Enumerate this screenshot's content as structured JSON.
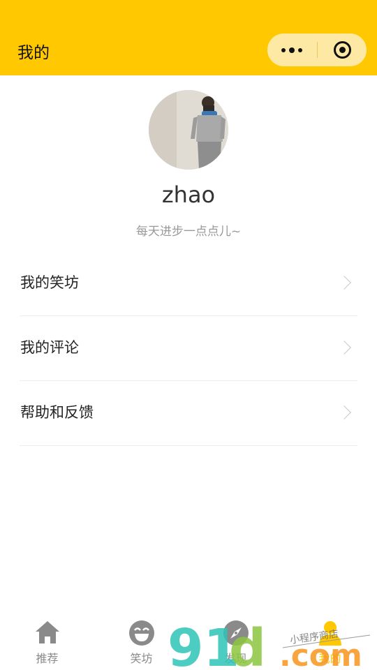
{
  "header": {
    "title": "我的"
  },
  "profile": {
    "username": "zhao",
    "motto": "每天进步一点点儿~"
  },
  "menu": [
    {
      "label": "我的笑坊"
    },
    {
      "label": "我的评论"
    },
    {
      "label": "帮助和反馈"
    }
  ],
  "tabbar": {
    "items": [
      {
        "label": "推荐",
        "icon": "home-icon"
      },
      {
        "label": "笑坊",
        "icon": "laugh-icon"
      },
      {
        "label": "发现",
        "icon": "compass-icon"
      },
      {
        "label": "我的",
        "icon": "user-icon",
        "active": true
      }
    ]
  },
  "watermark": {
    "brand": "91",
    "brand2": "d",
    "domain": ".com",
    "tagline": "小程序商店"
  },
  "colors": {
    "accent": "#ffc800",
    "watermark_teal": "#2ec4b6",
    "watermark_green": "#8cc63f",
    "watermark_orange": "#f7941d"
  }
}
